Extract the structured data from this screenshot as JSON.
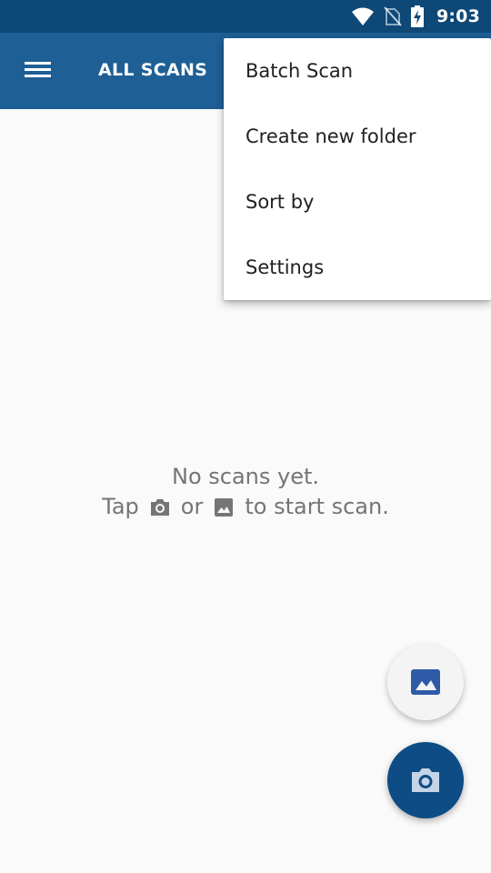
{
  "status_bar": {
    "time": "9:03"
  },
  "app_bar": {
    "title": "ALL SCANS"
  },
  "overflow_menu": {
    "items": [
      "Batch Scan",
      "Create new folder",
      "Sort by",
      "Settings"
    ]
  },
  "empty_state": {
    "line1": "No scans yet.",
    "tap_word": "Tap",
    "or_word": "or",
    "end_phrase": "to start scan."
  },
  "icons": {
    "menu": "hamburger-icon",
    "camera": "camera-icon",
    "gallery": "image-icon",
    "wifi": "wifi-icon",
    "no_sim": "no-sim-icon",
    "battery": "battery-charging-icon"
  },
  "colors": {
    "status_bar": "#0d4877",
    "app_bar": "#1e5f95",
    "fab_camera": "#0d4c84",
    "fab_gallery_icon": "#2e5aa8",
    "empty_text": "#757575"
  }
}
